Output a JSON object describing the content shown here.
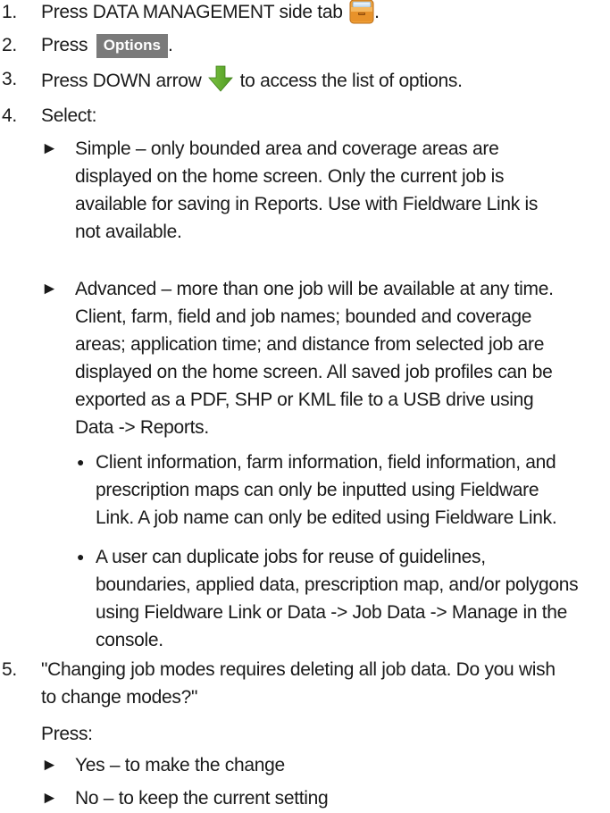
{
  "steps": [
    {
      "number": "1.",
      "text_before": "Press DATA MANAGEMENT side tab",
      "icon": "data-management-tab-icon",
      "text_after": "."
    },
    {
      "number": "2.",
      "text_before": "Press",
      "button_label": "Options",
      "text_after": "."
    },
    {
      "number": "3.",
      "text_before": "Press DOWN arrow",
      "icon": "green-down-arrow-icon",
      "text_after": "to access the list of options."
    },
    {
      "number": "4.",
      "text": "Select:",
      "options": [
        {
          "lines": [
            "Simple – only bounded area and coverage areas are",
            "displayed on the home screen. Only the current job is",
            "available for saving in Reports. Use with Fieldware Link is",
            "not available."
          ]
        },
        {
          "lines": [
            "Advanced – more than one job will be available at any time.",
            "Client, farm, field and job names; bounded and coverage",
            "areas; application time; and distance from selected job are",
            "displayed on the home screen. All saved job profiles can be",
            "exported as a PDF, SHP or KML file to a USB drive using",
            "Data -> Reports."
          ],
          "bullets": [
            {
              "lines": [
                "Client information, farm information, field information, and",
                "prescription maps can only be inputted using Fieldware",
                "Link. A job name can only be edited using Fieldware Link."
              ]
            },
            {
              "lines": [
                "A user can duplicate jobs for reuse of guidelines,",
                "boundaries, applied data, prescription map, and/or polygons",
                "using Fieldware Link or Data -> Job Data -> Manage in the",
                "console."
              ]
            }
          ]
        }
      ]
    },
    {
      "number": "5.",
      "lines": [
        "\"Changing job modes requires deleting all job data. Do you wish",
        "to change modes?\""
      ],
      "press_label": "Press:",
      "options": [
        "Yes – to make the change",
        "No – to keep the current setting"
      ]
    }
  ],
  "glyphs": {
    "triangle": "►",
    "bullet": "●"
  },
  "colors": {
    "text": "#1a1a1a",
    "options_button_bg": "#7a7a7a",
    "options_button_text": "#ffffff",
    "arrow_green": "#5aa02c",
    "tab_icon_orange": "#e8922a"
  }
}
